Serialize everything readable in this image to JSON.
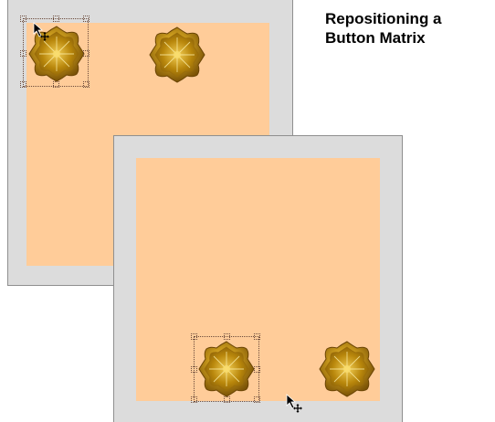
{
  "title": {
    "line1": "Repositioning a",
    "line2": "Button Matrix"
  },
  "icons": {
    "button_shape": "gold-star-flower-icon",
    "cursor": "move-pointer-cursor-icon",
    "handle": "selection-handle"
  },
  "colors": {
    "canvas": "#ffcc99",
    "frame": "#dcdcdc",
    "button_gold": "#c99a1c",
    "button_gold_dark": "#7a5206",
    "selection": "#6b4a3a"
  }
}
